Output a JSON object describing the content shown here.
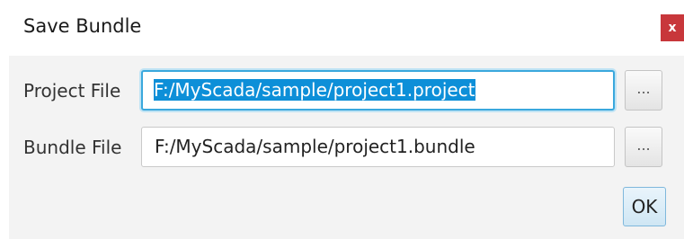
{
  "window": {
    "title": "Save Bundle",
    "close_label": "x"
  },
  "project_file": {
    "label": "Project File",
    "value": "F:/MyScada/sample/project1.project",
    "browse_label": "..."
  },
  "bundle_file": {
    "label": "Bundle File",
    "value": "F:/MyScada/sample/project1.bundle",
    "browse_label": "..."
  },
  "actions": {
    "ok_label": "OK"
  },
  "colors": {
    "close_button": "#c8373b",
    "focus_border": "#3aa8dd",
    "selection": "#0d8fd8",
    "ok_button": "#cfe6f4"
  }
}
